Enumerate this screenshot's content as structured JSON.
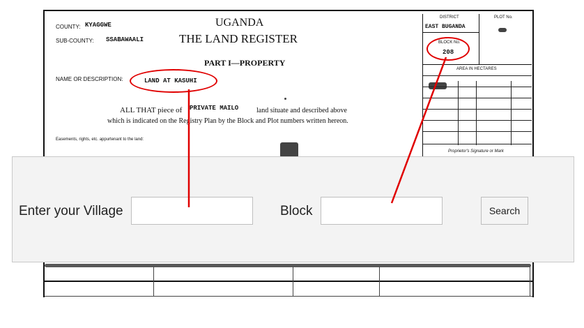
{
  "document": {
    "county_label": "COUNTY:",
    "county_value": "KYAGGWE",
    "subcounty_label": "SUB-COUNTY:",
    "subcounty_value": "SSABAWAALI",
    "country": "UGANDA",
    "register_title": "THE LAND REGISTER",
    "part_title": "PART I—PROPERTY",
    "name_label": "NAME OR DESCRIPTION:",
    "name_value": "LAND AT KASUHI",
    "all_that": "ALL THAT piece of",
    "tenure": "PRIVATE  MAILO",
    "land_situate": "land situate and described above",
    "which_is": "which is indicated on the Registry Plan by the Block and Plot numbers written hereon.",
    "easements": "Easements, rights, etc. appurtenant to the land:",
    "district_label": "DISTRICT",
    "district_value": "EAST BUGANDA",
    "plot_label": "PLOT No.",
    "block_label": "BLOCK No.",
    "block_value": "208",
    "area_label": "AREA IN HECTARES",
    "signature_label": "Proprietor's Signature or Mark"
  },
  "form": {
    "village_label": "Enter your Village",
    "village_value": "",
    "block_label": "Block",
    "block_value": "",
    "search_label": "Search"
  },
  "colors": {
    "annotation": "#e00000",
    "overlay_bg": "#f3f3f3",
    "input_border": "#bfbfbf"
  }
}
